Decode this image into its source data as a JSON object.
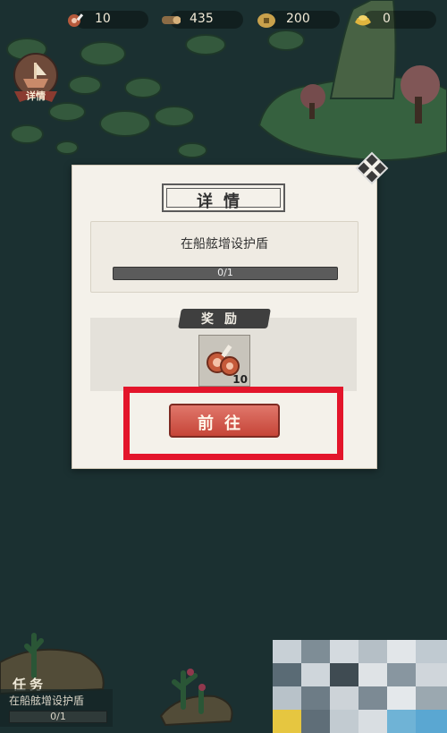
{
  "resources": [
    {
      "icon": "meat-icon",
      "value": "10"
    },
    {
      "icon": "wood-log-icon",
      "value": "435"
    },
    {
      "icon": "coin-icon",
      "value": "200"
    },
    {
      "icon": "gold-ingot-icon",
      "value": "0"
    }
  ],
  "side_button": {
    "label": "详情"
  },
  "dialog": {
    "title": "详情",
    "task_text": "在船舷增设护盾",
    "progress_text": "0/1",
    "progress_fraction": 0,
    "reward_title": "奖励",
    "reward_item": {
      "icon": "meat-icon",
      "count": "10"
    },
    "goto_label": "前往"
  },
  "task_panel": {
    "tag": "任务",
    "text": "在船舷增设护盾",
    "progress": "0/1"
  },
  "colors": {
    "highlight": "#e3152b",
    "button": "#c64538",
    "sea": "#25403f"
  }
}
